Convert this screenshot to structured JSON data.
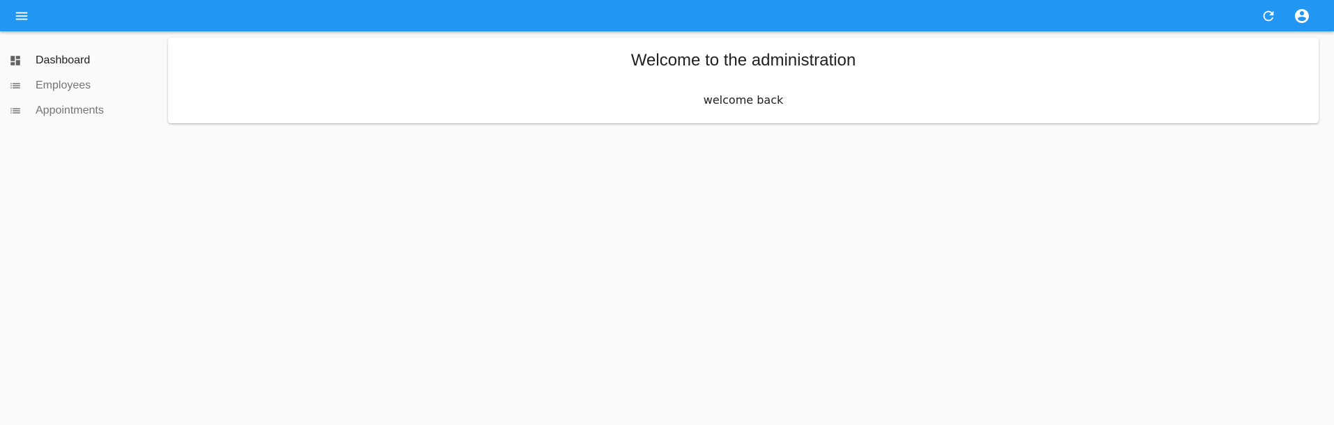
{
  "appbar": {
    "color": "#2196f3",
    "menu_icon": "menu-icon",
    "refresh_icon": "refresh-icon",
    "account_icon": "account-circle-icon"
  },
  "sidebar": {
    "items": [
      {
        "label": "Dashboard",
        "icon": "dashboard-icon",
        "active": true
      },
      {
        "label": "Employees",
        "icon": "list-icon",
        "active": false
      },
      {
        "label": "Appointments",
        "icon": "list-icon",
        "active": false
      }
    ]
  },
  "main": {
    "card": {
      "title": "Welcome to the administration",
      "body": "welcome back"
    }
  }
}
